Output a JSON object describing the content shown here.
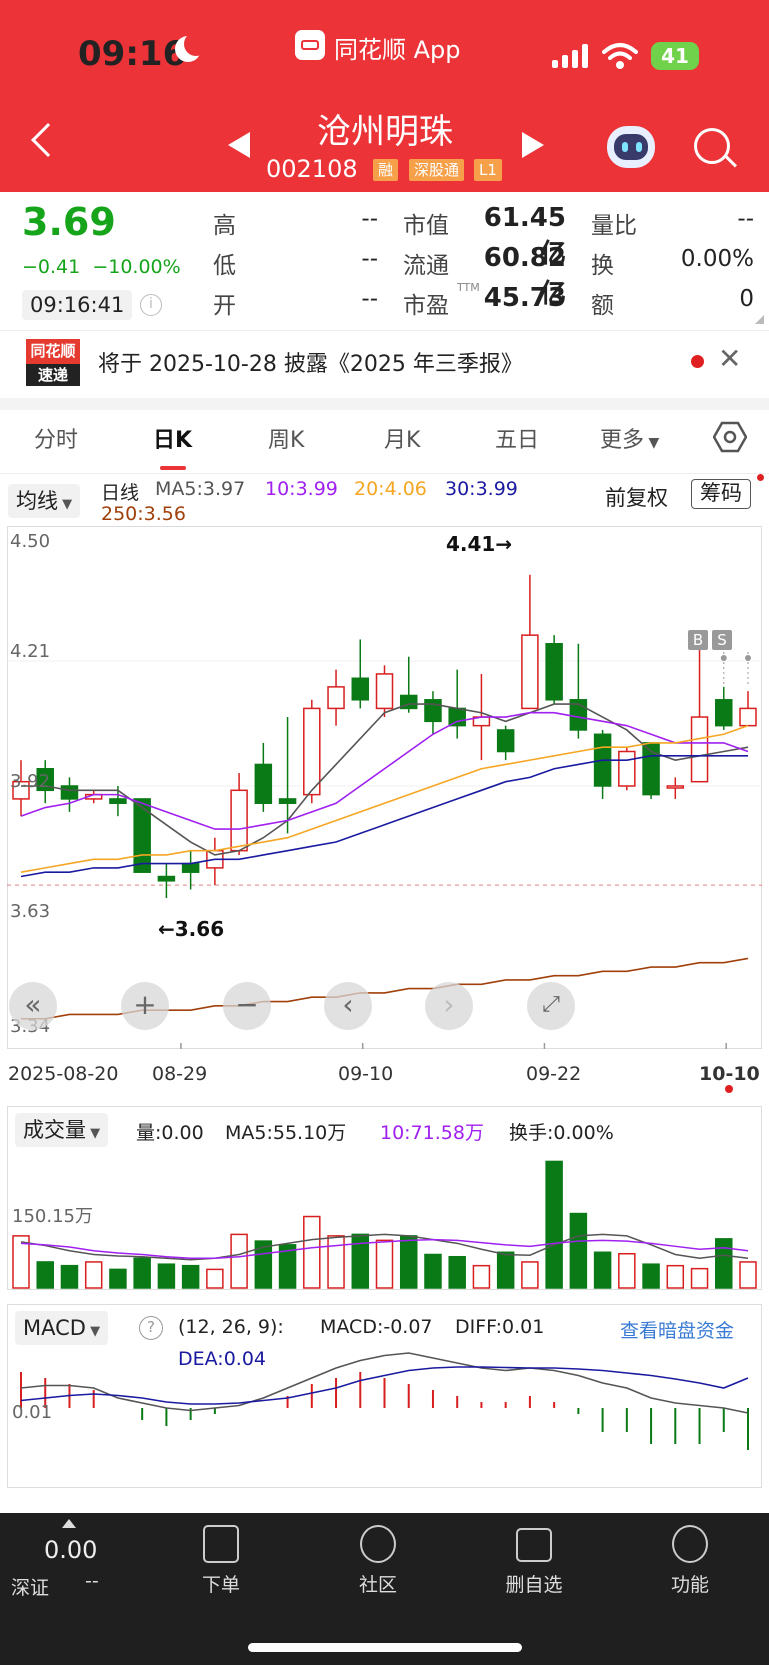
{
  "status_bar": {
    "time": "09:16",
    "app_name": "同花顺 App",
    "battery": "41"
  },
  "header": {
    "stock_name": "沧州明珠",
    "stock_code": "002108",
    "tags": [
      "融",
      "深股通",
      "L1"
    ]
  },
  "quote": {
    "price": "3.69",
    "change": "−0.41",
    "change_pct": "−10.00%",
    "time": "09:16:41",
    "fields": [
      {
        "label": "高",
        "value": "--"
      },
      {
        "label": "低",
        "value": "--"
      },
      {
        "label": "开",
        "value": "--"
      },
      {
        "label": "市值",
        "value": "61.45亿"
      },
      {
        "label": "流通",
        "value": "60.82亿"
      },
      {
        "label": "市盈",
        "value": "45.73",
        "sup": "TTM"
      },
      {
        "label": "量比",
        "value": "--"
      },
      {
        "label": "换",
        "value": "0.00%"
      },
      {
        "label": "额",
        "value": "0"
      }
    ]
  },
  "banner": {
    "logo_top": "同花顺",
    "logo_bottom": "速递",
    "text": "将于 2025-10-28 披露《2025 年三季报》"
  },
  "tabs": [
    "分时",
    "日K",
    "周K",
    "月K",
    "五日",
    "更多"
  ],
  "active_tab": "日K",
  "kline": {
    "dropdown": "均线",
    "period": "日线",
    "ma": [
      {
        "label": "MA5:3.97",
        "color": "#555555"
      },
      {
        "label": "10:3.99",
        "color": "#a020f0"
      },
      {
        "label": "20:4.06",
        "color": "#f5a623"
      },
      {
        "label": "30:3.99",
        "color": "#1a1aa0"
      },
      {
        "label": "250:3.56",
        "color": "#a0400a"
      }
    ],
    "adjust": "前复权",
    "chips": "筹码",
    "y_labels": [
      "4.50",
      "4.21",
      "3.92",
      "3.63",
      "3.34"
    ],
    "high_mark": "4.41→",
    "low_mark": "←3.66",
    "bs": [
      "B",
      "S"
    ],
    "x_labels": [
      "2025-08-20",
      "08-29",
      "09-10",
      "09-22",
      "10-10"
    ]
  },
  "volume": {
    "dropdown": "成交量",
    "vol": "量:0.00",
    "ma5": "MA5:55.10万",
    "ma10": "10:71.58万",
    "turnover": "换手:0.00%",
    "y_label": "150.15万"
  },
  "macd": {
    "dropdown": "MACD",
    "params": "(12, 26, 9):",
    "macd": "MACD:-0.07",
    "diff": "DIFF:0.01",
    "dea": "DEA:0.04",
    "link": "查看暗盘资金",
    "y_label": "0.01"
  },
  "bottom_nav": {
    "index_value": "0.00",
    "index_name": "深证",
    "index_change": "--",
    "items": [
      "下单",
      "社区",
      "删自选",
      "功能"
    ]
  },
  "chart_data": {
    "type": "candlestick",
    "ylim": [
      3.34,
      4.5
    ],
    "x_labels": [
      "2025-08-20",
      "08-29",
      "09-10",
      "09-22",
      "10-10"
    ],
    "candles": [
      {
        "o": 3.89,
        "c": 3.93,
        "h": 3.98,
        "l": 3.85
      },
      {
        "o": 3.96,
        "c": 3.91,
        "h": 3.98,
        "l": 3.88
      },
      {
        "o": 3.92,
        "c": 3.89,
        "h": 3.94,
        "l": 3.86
      },
      {
        "o": 3.89,
        "c": 3.9,
        "h": 3.91,
        "l": 3.88
      },
      {
        "o": 3.89,
        "c": 3.88,
        "h": 3.92,
        "l": 3.85
      },
      {
        "o": 3.89,
        "c": 3.72,
        "h": 3.89,
        "l": 3.72
      },
      {
        "o": 3.71,
        "c": 3.7,
        "h": 3.74,
        "l": 3.66
      },
      {
        "o": 3.74,
        "c": 3.72,
        "h": 3.77,
        "l": 3.68
      },
      {
        "o": 3.73,
        "c": 3.77,
        "h": 3.8,
        "l": 3.69
      },
      {
        "o": 3.77,
        "c": 3.91,
        "h": 3.95,
        "l": 3.76
      },
      {
        "o": 3.97,
        "c": 3.88,
        "h": 4.02,
        "l": 3.86
      },
      {
        "o": 3.89,
        "c": 3.88,
        "h": 4.08,
        "l": 3.81
      },
      {
        "o": 3.9,
        "c": 4.1,
        "h": 4.12,
        "l": 3.88
      },
      {
        "o": 4.1,
        "c": 4.15,
        "h": 4.19,
        "l": 4.06
      },
      {
        "o": 4.17,
        "c": 4.12,
        "h": 4.26,
        "l": 4.1
      },
      {
        "o": 4.1,
        "c": 4.18,
        "h": 4.2,
        "l": 4.08
      },
      {
        "o": 4.13,
        "c": 4.1,
        "h": 4.22,
        "l": 4.09
      },
      {
        "o": 4.12,
        "c": 4.07,
        "h": 4.14,
        "l": 4.04
      },
      {
        "o": 4.1,
        "c": 4.06,
        "h": 4.19,
        "l": 4.03
      },
      {
        "o": 4.06,
        "c": 4.08,
        "h": 4.18,
        "l": 3.98
      },
      {
        "o": 4.05,
        "c": 4.0,
        "h": 4.06,
        "l": 3.98
      },
      {
        "o": 4.1,
        "c": 4.27,
        "h": 4.41,
        "l": 4.1
      },
      {
        "o": 4.25,
        "c": 4.12,
        "h": 4.27,
        "l": 4.11
      },
      {
        "o": 4.12,
        "c": 4.05,
        "h": 4.25,
        "l": 4.03
      },
      {
        "o": 4.04,
        "c": 3.92,
        "h": 4.05,
        "l": 3.89
      },
      {
        "o": 3.92,
        "c": 4.0,
        "h": 4.01,
        "l": 3.91
      },
      {
        "o": 4.02,
        "c": 3.9,
        "h": 4.02,
        "l": 3.89
      },
      {
        "o": 3.92,
        "c": 3.92,
        "h": 3.94,
        "l": 3.89
      },
      {
        "o": 3.93,
        "c": 4.08,
        "h": 4.24,
        "l": 3.93
      },
      {
        "o": 4.12,
        "c": 4.06,
        "h": 4.15,
        "l": 4.05
      },
      {
        "o": 4.06,
        "c": 4.1,
        "h": 4.14,
        "l": 4.06
      }
    ],
    "ma_series": [
      {
        "name": "MA5",
        "color": "#555555",
        "values": [
          3.92,
          3.92,
          3.91,
          3.91,
          3.91,
          3.87,
          3.83,
          3.79,
          3.76,
          3.77,
          3.8,
          3.84,
          3.91,
          3.97,
          4.03,
          4.09,
          4.11,
          4.11,
          4.1,
          4.09,
          4.07,
          4.09,
          4.11,
          4.11,
          4.08,
          4.05,
          4.0,
          3.98,
          3.99,
          4.0,
          4.01
        ]
      },
      {
        "name": "MA10",
        "color": "#a020f0",
        "values": [
          3.85,
          3.87,
          3.88,
          3.9,
          3.9,
          3.88,
          3.86,
          3.84,
          3.82,
          3.82,
          3.83,
          3.84,
          3.86,
          3.88,
          3.92,
          3.96,
          4.0,
          4.04,
          4.07,
          4.08,
          4.08,
          4.09,
          4.09,
          4.08,
          4.07,
          4.06,
          4.04,
          4.02,
          4.02,
          4.02,
          4.0
        ]
      },
      {
        "name": "MA20",
        "color": "#f5a623",
        "values": [
          3.72,
          3.73,
          3.74,
          3.75,
          3.75,
          3.76,
          3.76,
          3.77,
          3.77,
          3.78,
          3.79,
          3.8,
          3.82,
          3.84,
          3.86,
          3.88,
          3.9,
          3.92,
          3.94,
          3.96,
          3.97,
          3.98,
          3.99,
          4.0,
          4.01,
          4.01,
          4.02,
          4.02,
          4.03,
          4.04,
          4.06
        ]
      },
      {
        "name": "MA30",
        "color": "#1a1aa0",
        "values": [
          3.71,
          3.72,
          3.72,
          3.73,
          3.73,
          3.74,
          3.74,
          3.74,
          3.75,
          3.75,
          3.76,
          3.77,
          3.78,
          3.79,
          3.81,
          3.83,
          3.85,
          3.87,
          3.89,
          3.91,
          3.93,
          3.94,
          3.96,
          3.97,
          3.98,
          3.98,
          3.99,
          3.99,
          3.99,
          3.99,
          3.99
        ]
      },
      {
        "name": "MA250",
        "color": "#a0400a",
        "values": [
          3.38,
          3.38,
          3.39,
          3.39,
          3.39,
          3.4,
          3.4,
          3.4,
          3.41,
          3.41,
          3.42,
          3.42,
          3.43,
          3.43,
          3.44,
          3.44,
          3.45,
          3.45,
          3.46,
          3.46,
          3.47,
          3.47,
          3.48,
          3.48,
          3.49,
          3.49,
          3.5,
          3.5,
          3.51,
          3.51,
          3.52
        ]
      }
    ],
    "volume": [
      70,
      35,
      30,
      35,
      25,
      40,
      32,
      30,
      25,
      72,
      63,
      58,
      96,
      70,
      72,
      64,
      70,
      45,
      42,
      30,
      48,
      35,
      170,
      100,
      48,
      46,
      32,
      30,
      26,
      66,
      35
    ],
    "volume_max": 150.15,
    "vol_ma5": [
      62,
      57,
      50,
      45,
      43,
      42,
      40,
      38,
      40,
      45,
      55,
      60,
      65,
      68,
      70,
      72,
      70,
      65,
      60,
      52,
      45,
      44,
      58,
      70,
      72,
      70,
      58,
      45,
      40,
      44,
      40
    ],
    "vol_ma10": [
      60,
      58,
      55,
      50,
      47,
      45,
      42,
      40,
      40,
      42,
      46,
      50,
      54,
      57,
      60,
      62,
      64,
      65,
      64,
      61,
      58,
      56,
      60,
      63,
      64,
      63,
      60,
      56,
      52,
      54,
      50
    ],
    "macd_hist": [
      0.06,
      0.05,
      0.04,
      0.03,
      0.0,
      -0.02,
      -0.03,
      -0.02,
      -0.01,
      0.0,
      0.0,
      0.02,
      0.04,
      0.05,
      0.06,
      0.05,
      0.04,
      0.03,
      0.02,
      0.01,
      0.01,
      0.02,
      0.01,
      -0.01,
      -0.04,
      -0.04,
      -0.06,
      -0.06,
      -0.06,
      -0.04,
      -0.07
    ],
    "diff": [
      0.02,
      0.025,
      0.025,
      0.02,
      0.0,
      -0.01,
      -0.02,
      -0.025,
      -0.02,
      -0.015,
      0.0,
      0.02,
      0.04,
      0.06,
      0.075,
      0.085,
      0.09,
      0.08,
      0.07,
      0.06,
      0.055,
      0.06,
      0.055,
      0.045,
      0.03,
      0.02,
      0.0,
      -0.01,
      -0.015,
      -0.02,
      -0.03
    ],
    "dea": [
      -0.005,
      0.0,
      0.005,
      0.008,
      0.005,
      0.0,
      -0.008,
      -0.012,
      -0.012,
      -0.01,
      -0.005,
      0.0,
      0.01,
      0.02,
      0.035,
      0.045,
      0.055,
      0.06,
      0.062,
      0.062,
      0.061,
      0.06,
      0.06,
      0.058,
      0.055,
      0.05,
      0.045,
      0.038,
      0.03,
      0.02,
      0.04
    ]
  }
}
